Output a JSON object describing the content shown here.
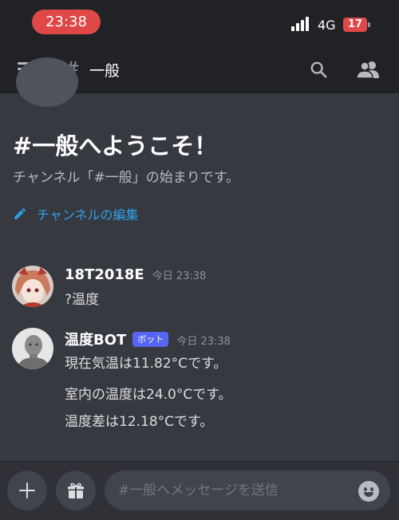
{
  "status_bar": {
    "time": "23:38",
    "network": "4G",
    "battery": "17"
  },
  "header": {
    "hash": "#",
    "channel_name": "一般"
  },
  "welcome": {
    "title": "#一般へようこそ！",
    "subtitle": "チャンネル「#一般」の始まりです。",
    "edit_link": "チャンネルの編集"
  },
  "messages": [
    {
      "username": "18T2018E",
      "timestamp": "今日 23:38",
      "lines": [
        "?温度"
      ]
    },
    {
      "username": "温度BOT",
      "bot_tag": "ボット",
      "timestamp": "今日 23:38",
      "lines": [
        "現在気温は11.82°Cです。",
        "室内の温度は24.0°Cです。",
        "温度差は12.18°Cです。"
      ]
    }
  ],
  "composer": {
    "placeholder": "#一般へメッセージを送信"
  },
  "icons": {
    "menu": "hamburger-icon",
    "search": "search-icon",
    "members": "members-icon",
    "edit": "pencil-icon",
    "add": "plus-icon",
    "gift": "gift-icon",
    "emoji": "emoji-icon"
  },
  "colors": {
    "accent": "#5865f2",
    "link": "#2fa1e8",
    "time_pill": "#e04848"
  }
}
